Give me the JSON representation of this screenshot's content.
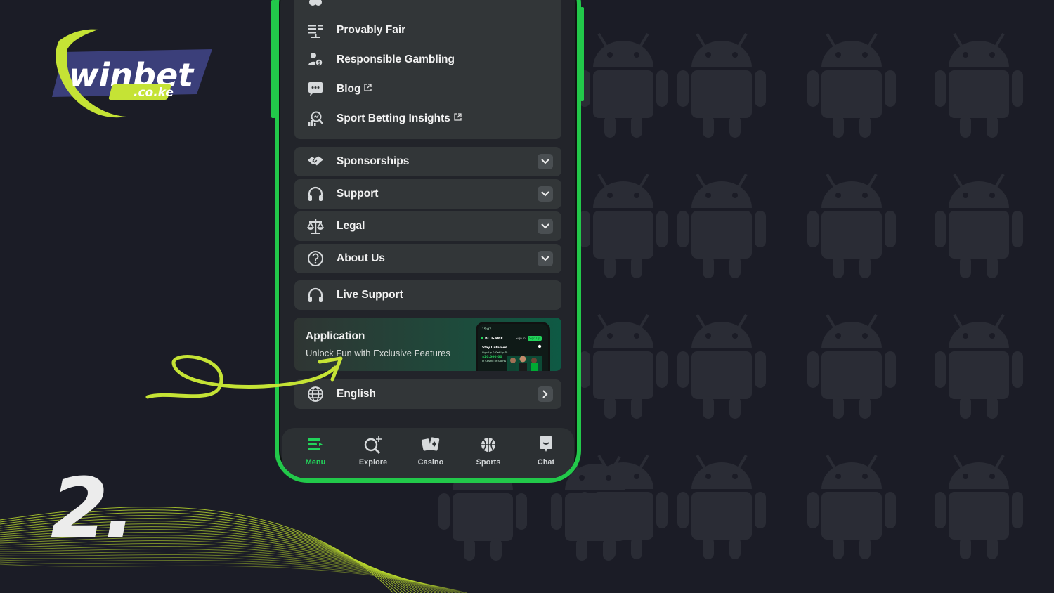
{
  "brand": {
    "logo_text": "winbet",
    "logo_domain": ".co.ke",
    "accent": "#c5e335",
    "logo_bg": "#3b3f7a"
  },
  "step": {
    "number": "2."
  },
  "colors": {
    "phone_frame": "#22c84a",
    "active_tab": "#22d35a",
    "background": "#1b1c26"
  },
  "menu": {
    "top_items": [
      {
        "label": "Provably Fair",
        "icon": "scale-list-icon",
        "external": false
      },
      {
        "label": "Responsible Gambling",
        "icon": "people-icon",
        "external": false
      },
      {
        "label": "Blog",
        "icon": "chat-bubble-icon",
        "external": true
      },
      {
        "label": "Sport Betting Insights",
        "icon": "insights-icon",
        "external": true
      }
    ],
    "accordions": [
      {
        "label": "Sponsorships",
        "icon": "handshake-icon"
      },
      {
        "label": "Support",
        "icon": "headset-icon"
      },
      {
        "label": "Legal",
        "icon": "justice-scale-icon"
      },
      {
        "label": "About Us",
        "icon": "question-circle-icon"
      }
    ],
    "live_support": {
      "label": "Live Support",
      "icon": "headset-icon"
    },
    "application": {
      "title": "Application",
      "subtitle": "Unlock Fun with Exclusive Features",
      "preview": {
        "time": "15:07",
        "brand": "BC.GAME",
        "sign_in": "Sign In",
        "sign_up": "Sign Up",
        "headline": "Stay Untamed",
        "line1": "Sign Up & Get Up To",
        "amount": "$20,000.00",
        "line2": "in Casino or Sports"
      }
    },
    "language": {
      "label": "English",
      "icon": "globe-icon"
    }
  },
  "tabbar": {
    "tabs": [
      {
        "label": "Menu",
        "icon": "menu-icon",
        "active": true
      },
      {
        "label": "Explore",
        "icon": "explore-search-icon",
        "active": false
      },
      {
        "label": "Casino",
        "icon": "cards-icon",
        "active": false
      },
      {
        "label": "Sports",
        "icon": "basketball-icon",
        "active": false
      },
      {
        "label": "Chat",
        "icon": "chat-icon",
        "active": false
      }
    ]
  }
}
